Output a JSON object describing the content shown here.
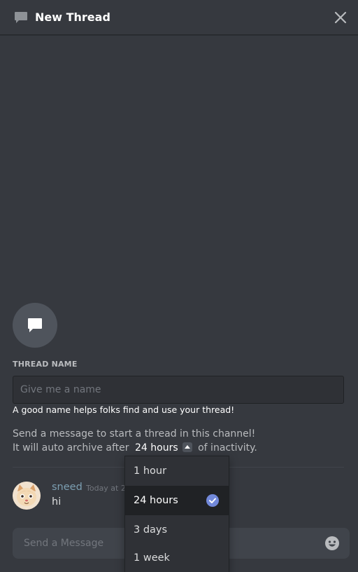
{
  "header": {
    "title": "New Thread",
    "icon": "thread-icon",
    "close_icon": "close-icon"
  },
  "form": {
    "label": "THREAD NAME",
    "placeholder": "Give me a name",
    "helper": "A good name helps folks find and use your thread!",
    "start_message": "Send a message to start a thread in this channel!",
    "archive_prefix": "It will auto archive after",
    "archive_value": "24 hours",
    "archive_suffix": "of inactivity."
  },
  "message": {
    "username": "sneed",
    "timestamp": "Today at 2:",
    "text": "hi"
  },
  "composer": {
    "placeholder": "Send a Message",
    "emoji_icon": "emoji-icon"
  },
  "dropdown": {
    "options": [
      "1 hour",
      "24 hours",
      "3 days",
      "1 week"
    ],
    "selected_index": 1,
    "check_color": "#7289da"
  },
  "colors": {
    "background": "#36393f",
    "input_bg": "#2f3136",
    "accent": "#7289da",
    "username": "#7c9fb2"
  }
}
